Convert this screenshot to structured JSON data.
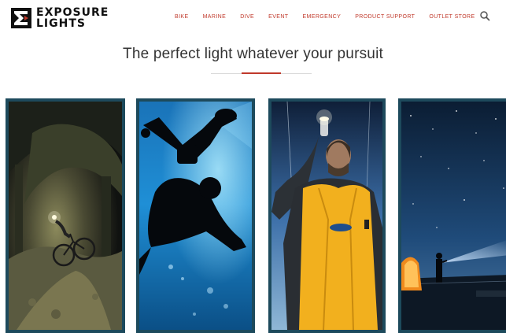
{
  "brand": {
    "line1": "EXPOSURE",
    "line2": "LIGHTS"
  },
  "nav": {
    "items": [
      "BIKE",
      "MARINE",
      "DIVE",
      "EVENT",
      "EMERGENCY",
      "PRODUCT SUPPORT",
      "OUTLET STORE"
    ],
    "search_icon": "search-icon"
  },
  "hero": {
    "tagline": "The perfect light whatever your pursuit"
  },
  "tiles": [
    {
      "name": "bike",
      "image": "mountain-biker-night-forest"
    },
    {
      "name": "dive",
      "image": "scuba-diver-silhouette-underwater"
    },
    {
      "name": "marine",
      "image": "sailor-holding-torch-yellow-jacket"
    },
    {
      "name": "event",
      "image": "person-shining-beam-starry-night"
    }
  ],
  "colors": {
    "accent": "#c0392b",
    "tile_border": "#1d4a5c",
    "text": "#333333"
  }
}
